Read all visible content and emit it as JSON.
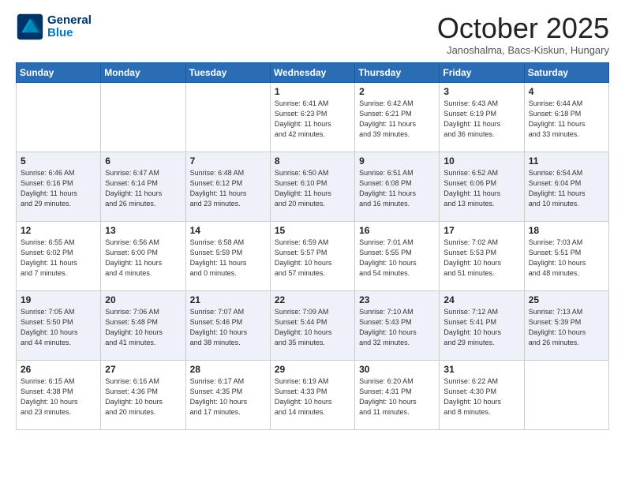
{
  "header": {
    "logo_general": "General",
    "logo_blue": "Blue",
    "month_title": "October 2025",
    "subtitle": "Janoshalma, Bacs-Kiskun, Hungary"
  },
  "days_of_week": [
    "Sunday",
    "Monday",
    "Tuesday",
    "Wednesday",
    "Thursday",
    "Friday",
    "Saturday"
  ],
  "weeks": [
    {
      "row_class": "week-row-1",
      "days": [
        {
          "num": "",
          "info": ""
        },
        {
          "num": "",
          "info": ""
        },
        {
          "num": "",
          "info": ""
        },
        {
          "num": "1",
          "info": "Sunrise: 6:41 AM\nSunset: 6:23 PM\nDaylight: 11 hours\nand 42 minutes."
        },
        {
          "num": "2",
          "info": "Sunrise: 6:42 AM\nSunset: 6:21 PM\nDaylight: 11 hours\nand 39 minutes."
        },
        {
          "num": "3",
          "info": "Sunrise: 6:43 AM\nSunset: 6:19 PM\nDaylight: 11 hours\nand 36 minutes."
        },
        {
          "num": "4",
          "info": "Sunrise: 6:44 AM\nSunset: 6:18 PM\nDaylight: 11 hours\nand 33 minutes."
        }
      ]
    },
    {
      "row_class": "week-row-2",
      "days": [
        {
          "num": "5",
          "info": "Sunrise: 6:46 AM\nSunset: 6:16 PM\nDaylight: 11 hours\nand 29 minutes."
        },
        {
          "num": "6",
          "info": "Sunrise: 6:47 AM\nSunset: 6:14 PM\nDaylight: 11 hours\nand 26 minutes."
        },
        {
          "num": "7",
          "info": "Sunrise: 6:48 AM\nSunset: 6:12 PM\nDaylight: 11 hours\nand 23 minutes."
        },
        {
          "num": "8",
          "info": "Sunrise: 6:50 AM\nSunset: 6:10 PM\nDaylight: 11 hours\nand 20 minutes."
        },
        {
          "num": "9",
          "info": "Sunrise: 6:51 AM\nSunset: 6:08 PM\nDaylight: 11 hours\nand 16 minutes."
        },
        {
          "num": "10",
          "info": "Sunrise: 6:52 AM\nSunset: 6:06 PM\nDaylight: 11 hours\nand 13 minutes."
        },
        {
          "num": "11",
          "info": "Sunrise: 6:54 AM\nSunset: 6:04 PM\nDaylight: 11 hours\nand 10 minutes."
        }
      ]
    },
    {
      "row_class": "week-row-3",
      "days": [
        {
          "num": "12",
          "info": "Sunrise: 6:55 AM\nSunset: 6:02 PM\nDaylight: 11 hours\nand 7 minutes."
        },
        {
          "num": "13",
          "info": "Sunrise: 6:56 AM\nSunset: 6:00 PM\nDaylight: 11 hours\nand 4 minutes."
        },
        {
          "num": "14",
          "info": "Sunrise: 6:58 AM\nSunset: 5:59 PM\nDaylight: 11 hours\nand 0 minutes."
        },
        {
          "num": "15",
          "info": "Sunrise: 6:59 AM\nSunset: 5:57 PM\nDaylight: 10 hours\nand 57 minutes."
        },
        {
          "num": "16",
          "info": "Sunrise: 7:01 AM\nSunset: 5:55 PM\nDaylight: 10 hours\nand 54 minutes."
        },
        {
          "num": "17",
          "info": "Sunrise: 7:02 AM\nSunset: 5:53 PM\nDaylight: 10 hours\nand 51 minutes."
        },
        {
          "num": "18",
          "info": "Sunrise: 7:03 AM\nSunset: 5:51 PM\nDaylight: 10 hours\nand 48 minutes."
        }
      ]
    },
    {
      "row_class": "week-row-4",
      "days": [
        {
          "num": "19",
          "info": "Sunrise: 7:05 AM\nSunset: 5:50 PM\nDaylight: 10 hours\nand 44 minutes."
        },
        {
          "num": "20",
          "info": "Sunrise: 7:06 AM\nSunset: 5:48 PM\nDaylight: 10 hours\nand 41 minutes."
        },
        {
          "num": "21",
          "info": "Sunrise: 7:07 AM\nSunset: 5:46 PM\nDaylight: 10 hours\nand 38 minutes."
        },
        {
          "num": "22",
          "info": "Sunrise: 7:09 AM\nSunset: 5:44 PM\nDaylight: 10 hours\nand 35 minutes."
        },
        {
          "num": "23",
          "info": "Sunrise: 7:10 AM\nSunset: 5:43 PM\nDaylight: 10 hours\nand 32 minutes."
        },
        {
          "num": "24",
          "info": "Sunrise: 7:12 AM\nSunset: 5:41 PM\nDaylight: 10 hours\nand 29 minutes."
        },
        {
          "num": "25",
          "info": "Sunrise: 7:13 AM\nSunset: 5:39 PM\nDaylight: 10 hours\nand 26 minutes."
        }
      ]
    },
    {
      "row_class": "week-row-5",
      "days": [
        {
          "num": "26",
          "info": "Sunrise: 6:15 AM\nSunset: 4:38 PM\nDaylight: 10 hours\nand 23 minutes."
        },
        {
          "num": "27",
          "info": "Sunrise: 6:16 AM\nSunset: 4:36 PM\nDaylight: 10 hours\nand 20 minutes."
        },
        {
          "num": "28",
          "info": "Sunrise: 6:17 AM\nSunset: 4:35 PM\nDaylight: 10 hours\nand 17 minutes."
        },
        {
          "num": "29",
          "info": "Sunrise: 6:19 AM\nSunset: 4:33 PM\nDaylight: 10 hours\nand 14 minutes."
        },
        {
          "num": "30",
          "info": "Sunrise: 6:20 AM\nSunset: 4:31 PM\nDaylight: 10 hours\nand 11 minutes."
        },
        {
          "num": "31",
          "info": "Sunrise: 6:22 AM\nSunset: 4:30 PM\nDaylight: 10 hours\nand 8 minutes."
        },
        {
          "num": "",
          "info": ""
        }
      ]
    }
  ]
}
